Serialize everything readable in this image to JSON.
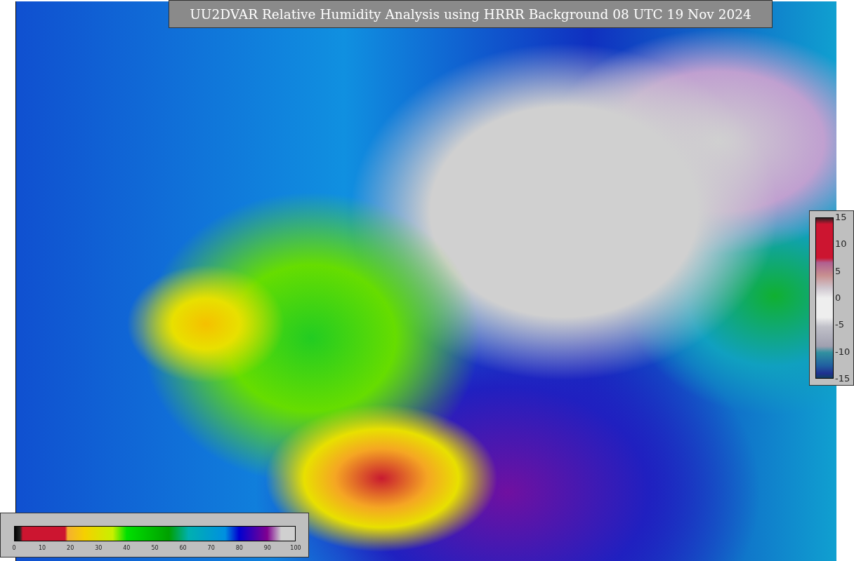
{
  "title": "UU2DVAR Relative Humidity Analysis using HRRR Background 08 UTC 19 Nov 2024",
  "humidity_colorbar": {
    "ticks": [
      "0",
      "10",
      "20",
      "30",
      "40",
      "50",
      "60",
      "70",
      "80",
      "90",
      "100"
    ]
  },
  "difference_colorbar": {
    "ticks": [
      "15",
      "10",
      "5",
      "0",
      "-5",
      "-10",
      "-15"
    ]
  }
}
